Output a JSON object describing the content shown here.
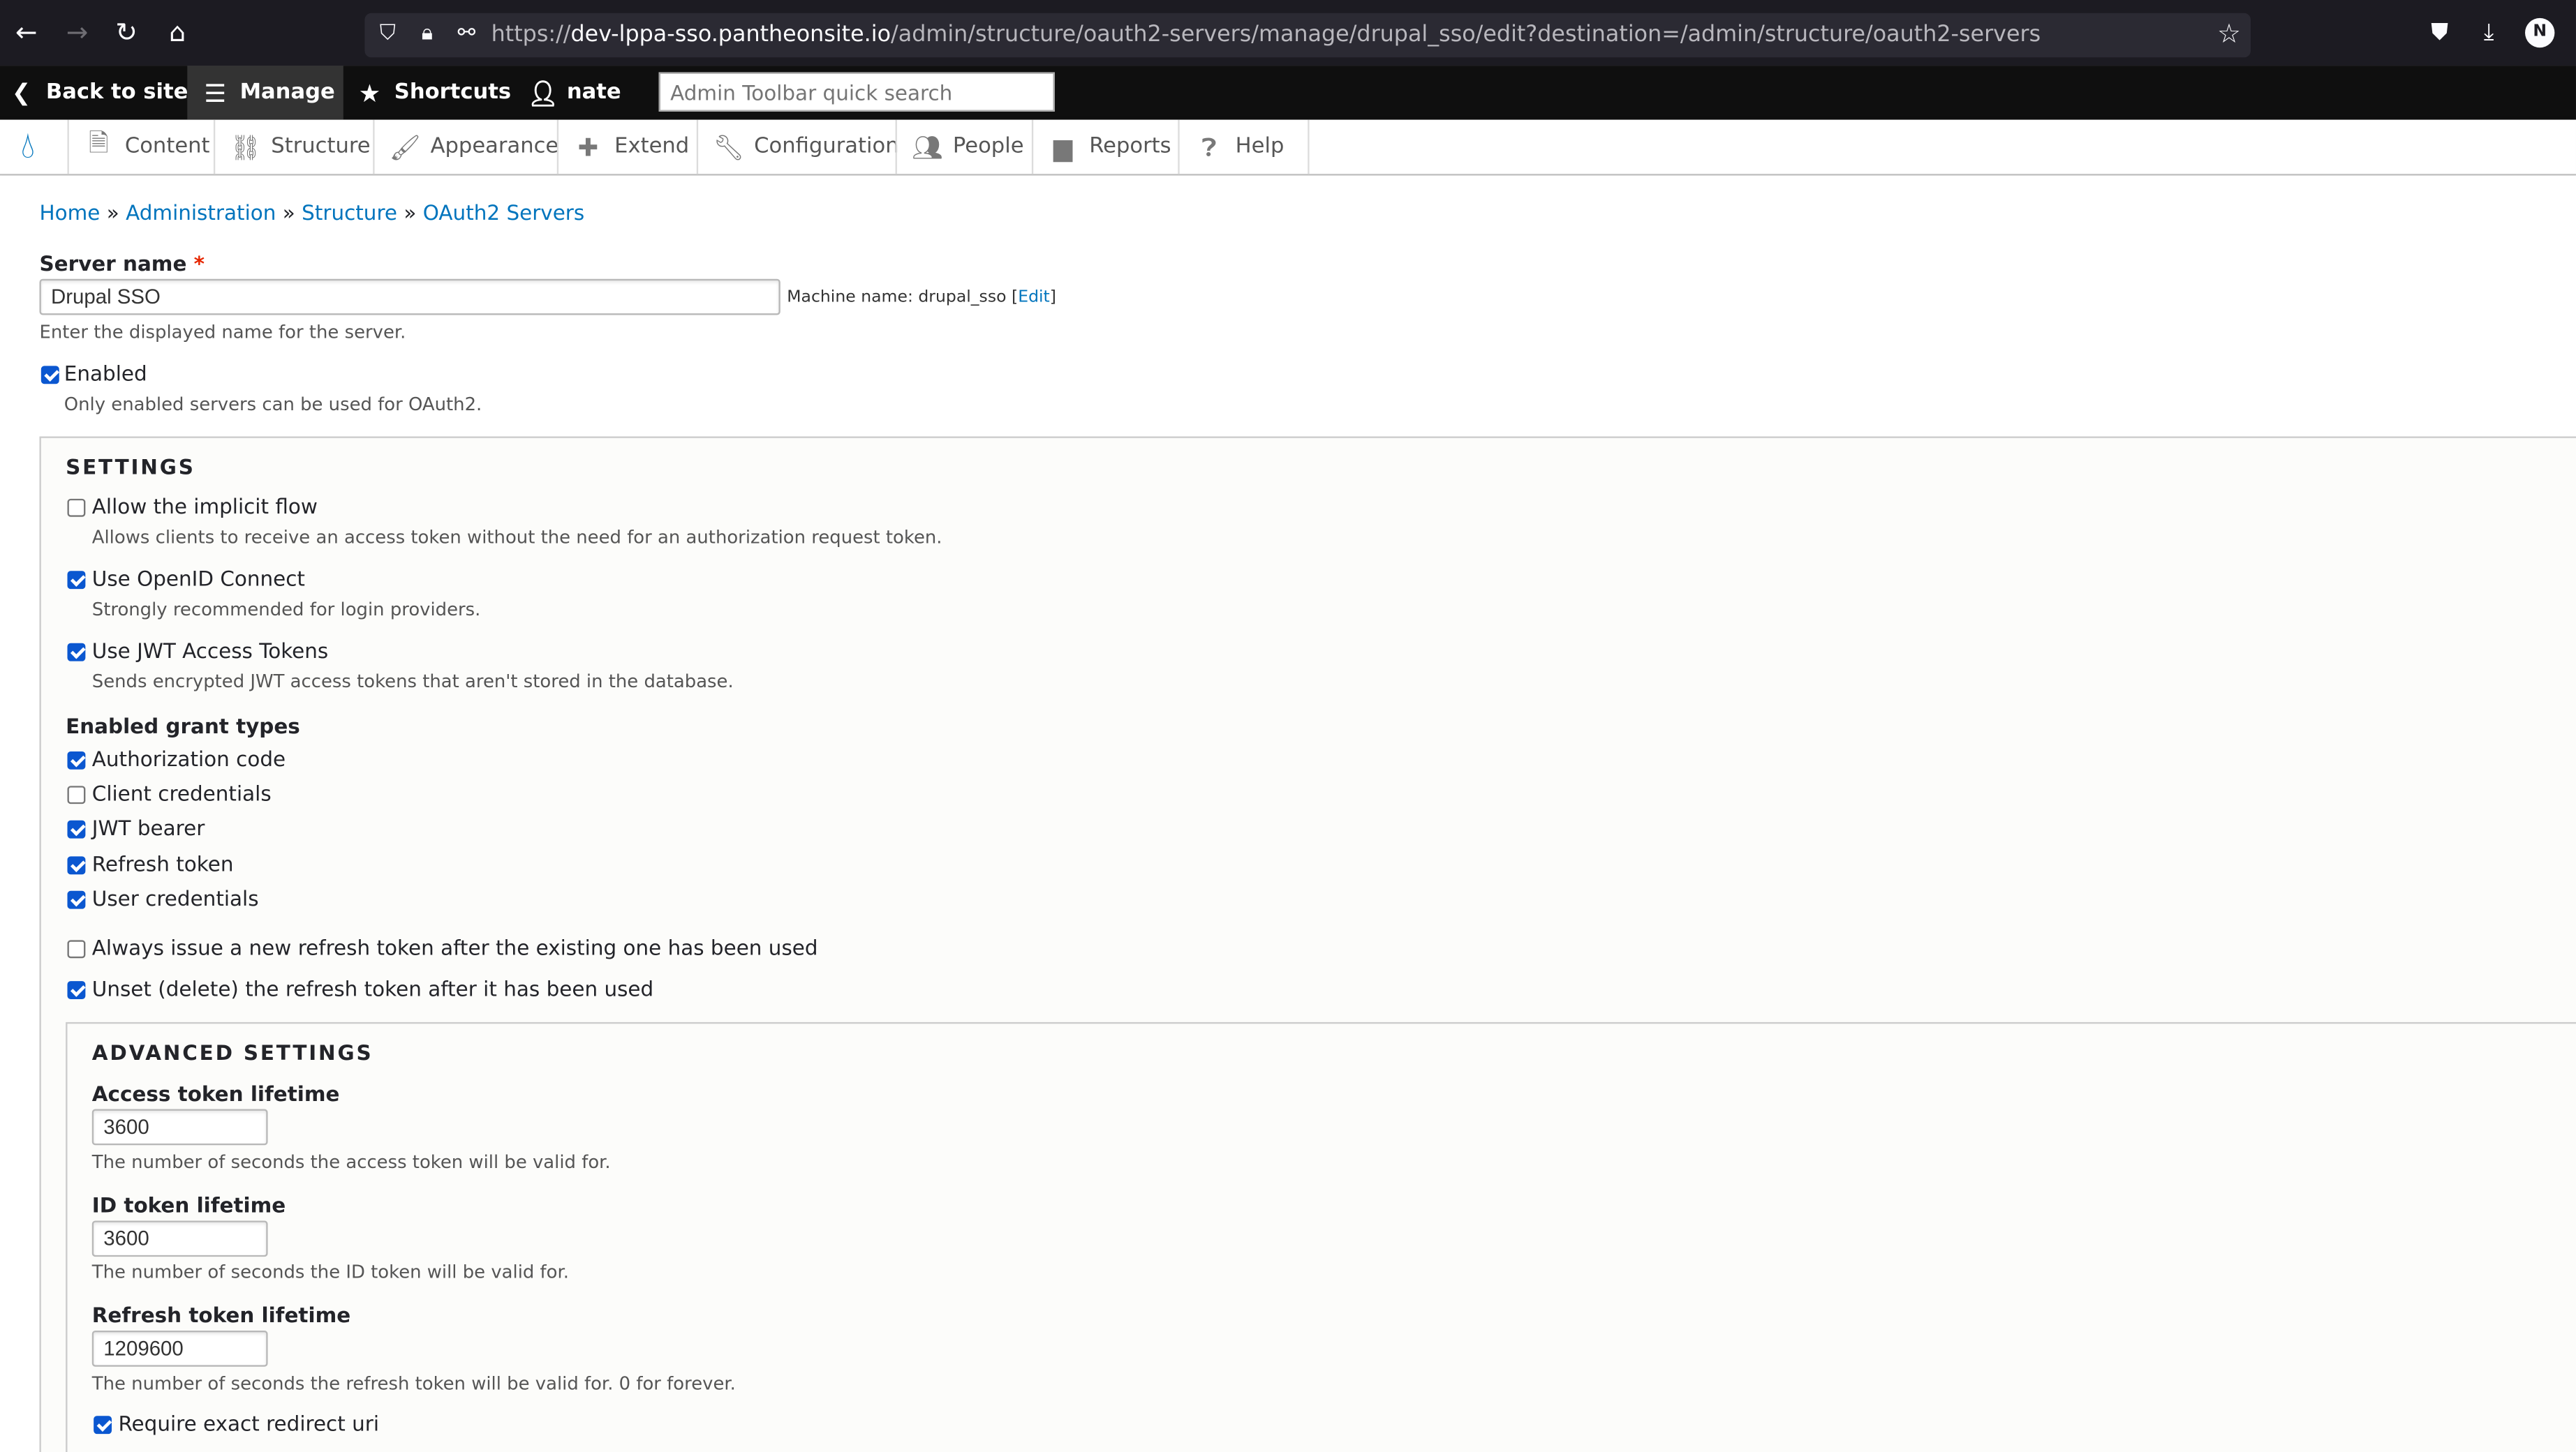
{
  "browser": {
    "url_prefix": "https://",
    "url_host": "dev-lppa-sso.pantheonsite.io",
    "url_path": "/admin/structure/oauth2-servers/manage/drupal_sso/edit?destination=/admin/structure/oauth2-servers",
    "profile_initial": "N"
  },
  "toolbar": {
    "back_label": "Back to site",
    "manage_label": "Manage",
    "shortcuts_label": "Shortcuts",
    "user_label": "nate",
    "search_placeholder": "Admin Toolbar quick search"
  },
  "menu": {
    "items": [
      {
        "label": "Content"
      },
      {
        "label": "Structure"
      },
      {
        "label": "Appearance"
      },
      {
        "label": "Extend"
      },
      {
        "label": "Configuration"
      },
      {
        "label": "People"
      },
      {
        "label": "Reports"
      },
      {
        "label": "Help"
      }
    ]
  },
  "breadcrumb": {
    "items": [
      "Home",
      "Administration",
      "Structure",
      "OAuth2 Servers"
    ],
    "separator": "»"
  },
  "form": {
    "server_name_label": "Server name",
    "required_mark": "*",
    "server_name_value": "Drupal SSO",
    "machine_name_prefix": "Machine name: drupal_sso",
    "machine_name_edit": "Edit",
    "server_name_desc": "Enter the displayed name for the server.",
    "enabled_label": "Enabled",
    "enabled_desc": "Only enabled servers can be used for OAuth2.",
    "settings": {
      "title": "SETTINGS",
      "implicit_label": "Allow the implicit flow",
      "implicit_desc": "Allows clients to receive an access token without the need for an authorization request token.",
      "openid_label": "Use OpenID Connect",
      "openid_desc": "Strongly recommended for login providers.",
      "jwt_label": "Use JWT Access Tokens",
      "jwt_desc": "Sends encrypted JWT access tokens that aren't stored in the database.",
      "grant_types_label": "Enabled grant types",
      "grant_types": [
        {
          "label": "Authorization code",
          "checked": true
        },
        {
          "label": "Client credentials",
          "checked": false
        },
        {
          "label": "JWT bearer",
          "checked": true
        },
        {
          "label": "Refresh token",
          "checked": true
        },
        {
          "label": "User credentials",
          "checked": true
        }
      ],
      "always_issue_label": "Always issue a new refresh token after the existing one has been used",
      "unset_label": "Unset (delete) the refresh token after it has been used"
    },
    "advanced": {
      "title": "ADVANCED SETTINGS",
      "access_label": "Access token lifetime",
      "access_value": "3600",
      "access_desc": "The number of seconds the access token will be valid for.",
      "id_label": "ID token lifetime",
      "id_value": "3600",
      "id_desc": "The number of seconds the ID token will be valid for.",
      "refresh_label": "Refresh token lifetime",
      "refresh_value": "1209600",
      "refresh_desc": "The number of seconds the refresh token will be valid for. 0 for forever.",
      "exact_uri_label": "Require exact redirect uri"
    }
  },
  "colors": {
    "link": "#0074bd",
    "drupal_blue": "#0678be",
    "checkbox_checked": "#0b57d0",
    "toolbar_bg": "#0f0f0f"
  }
}
